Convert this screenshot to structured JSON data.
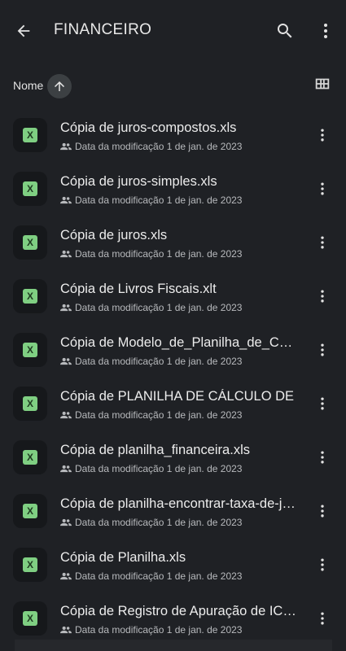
{
  "header": {
    "title": "FINANCEIRO",
    "back_icon": "arrow-back-icon",
    "search_icon": "search-icon",
    "more_icon": "more-vert-icon"
  },
  "sort": {
    "label": "Nome",
    "direction_icon": "arrow-up-icon",
    "view_toggle_icon": "grid-view-icon"
  },
  "files": [
    {
      "name": "Cópia de juros-compostos.xls",
      "meta": "Data da modificação 1 de jan. de 2023",
      "type_badge": "X"
    },
    {
      "name": "Cópia de juros-simples.xls",
      "meta": "Data da modificação 1 de jan. de 2023",
      "type_badge": "X"
    },
    {
      "name": "Cópia de juros.xls",
      "meta": "Data da modificação 1 de jan. de 2023",
      "type_badge": "X"
    },
    {
      "name": "Cópia de Livros Fiscais.xlt",
      "meta": "Data da modificação 1 de jan. de 2023",
      "type_badge": "X"
    },
    {
      "name": "Cópia de Modelo_de_Planilha_de_Cálculo",
      "meta": "Data da modificação 1 de jan. de 2023",
      "type_badge": "X"
    },
    {
      "name": "Cópia de PLANILHA DE CÁLCULO DE",
      "meta": "Data da modificação 1 de jan. de 2023",
      "type_badge": "X"
    },
    {
      "name": "Cópia de planilha_financeira.xls",
      "meta": "Data da modificação 1 de jan. de 2023",
      "type_badge": "X"
    },
    {
      "name": "Cópia de planilha-encontrar-taxa-de-juros",
      "meta": "Data da modificação 1 de jan. de 2023",
      "type_badge": "X"
    },
    {
      "name": "Cópia de Planilha.xls",
      "meta": "Data da modificação 1 de jan. de 2023",
      "type_badge": "X"
    },
    {
      "name": "Cópia de Registro de Apuração de ICMS",
      "meta": "Data da modificação 1 de jan. de 2023",
      "type_badge": "X"
    }
  ],
  "colors": {
    "background": "#1f2125",
    "sheet_badge": "#7fcf82",
    "text_primary": "#ececec",
    "text_secondary": "#b8babd"
  }
}
